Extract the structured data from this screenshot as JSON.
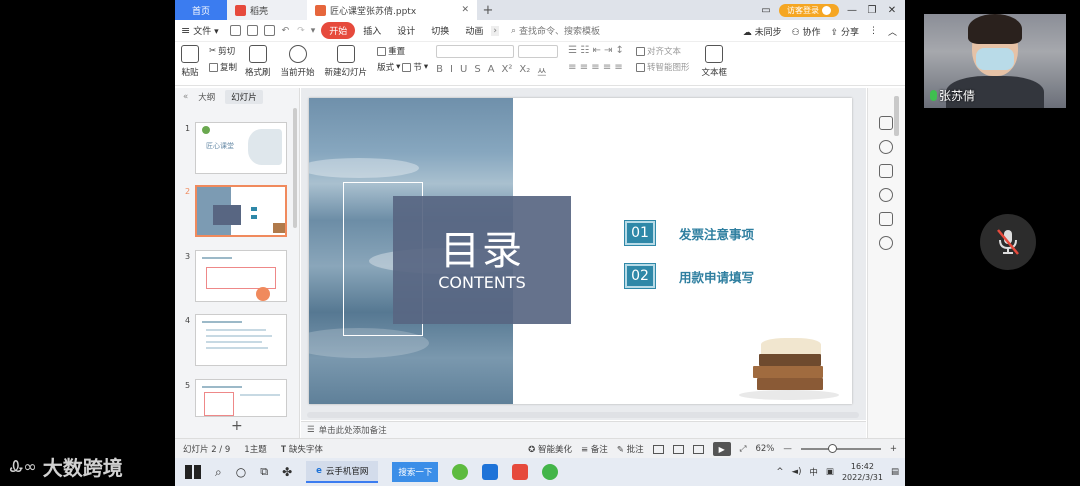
{
  "tabbar": {
    "home_label": "首页",
    "tabs": [
      {
        "label": "稻壳",
        "icon": "docer-icon",
        "color": "#e64a3c"
      },
      {
        "label": "匠心课堂张苏倩.pptx",
        "icon": "pptx-icon",
        "color": "#e6663c"
      }
    ],
    "login_label": "访客登录"
  },
  "menubar": {
    "file_label": "文件",
    "items": [
      "开始",
      "插入",
      "设计",
      "切换",
      "动画"
    ],
    "active": "开始",
    "search_placeholder": "查找命令、搜索模板",
    "right": [
      "未同步",
      "协作",
      "分享"
    ]
  },
  "ribbon": {
    "paste": "粘贴",
    "cut": "剪切",
    "copy": "复制",
    "format_painter": "格式刷",
    "from_start": "当前开始",
    "new_slide": "新建幻灯片",
    "layout": "版式",
    "reset": "重置",
    "section": "节",
    "align_text": "对齐文本",
    "convert_smartart": "转智能图形",
    "textbox": "文本框"
  },
  "leftpane": {
    "tabs": [
      "大纲",
      "幻灯片"
    ],
    "active_tab": "幻灯片",
    "slide_numbers": [
      "1",
      "2",
      "3",
      "4",
      "5"
    ],
    "selected": 2,
    "thumb1_title": "匠心课堂"
  },
  "slide": {
    "title": "目录",
    "subtitle": "CONTENTS",
    "items": [
      {
        "num": "01",
        "text": "发票注意事项"
      },
      {
        "num": "02",
        "text": "用款申请填写"
      }
    ],
    "accent": "#2f88a8",
    "box_color": "#586682"
  },
  "notes": {
    "placeholder": "单击此处添加备注"
  },
  "statusbar": {
    "slide_info": "幻灯片 2 / 9",
    "theme": "1主题",
    "missing_font": "缺失字体",
    "smart_beautify": "智能美化",
    "notes": "备注",
    "comments": "批注",
    "zoom": "62%"
  },
  "taskbar": {
    "app_label": "云手机官网",
    "search_label": "搜索一下",
    "time": "16:42",
    "date": "2022/3/31",
    "ime": "中"
  },
  "video": {
    "name": "张苏倩",
    "watermark": "大数跨境"
  }
}
